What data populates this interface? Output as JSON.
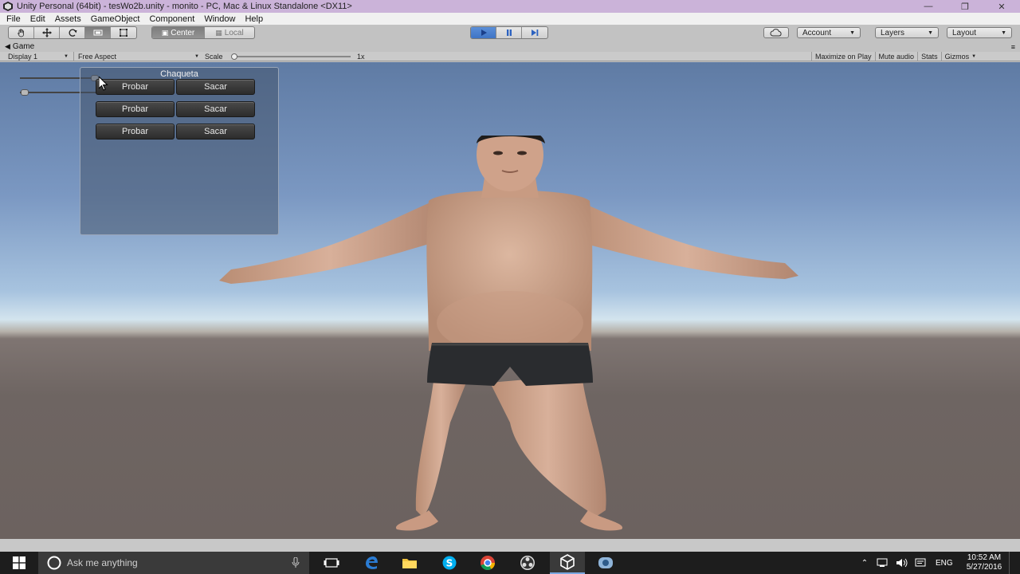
{
  "window": {
    "title": "Unity Personal (64bit) - tesWo2b.unity - monito - PC, Mac & Linux Standalone <DX11>"
  },
  "menu": [
    "File",
    "Edit",
    "Assets",
    "GameObject",
    "Component",
    "Window",
    "Help"
  ],
  "toolbar": {
    "pivot_center": "Center",
    "pivot_local": "Local",
    "account": "Account",
    "layers": "Layers",
    "layout": "Layout"
  },
  "game_view": {
    "tab_label": "Game",
    "display": "Display 1",
    "aspect": "Free Aspect",
    "scale_label": "Scale",
    "scale_value": "1x",
    "maximize_on_play": "Maximize on Play",
    "mute_audio": "Mute audio",
    "stats": "Stats",
    "gizmos": "Gizmos"
  },
  "gui_panel": {
    "title": "Chaqueta",
    "rows": [
      {
        "try": "Probar",
        "remove": "Sacar"
      },
      {
        "try": "Probar",
        "remove": "Sacar"
      },
      {
        "try": "Probar",
        "remove": "Sacar"
      }
    ]
  },
  "taskbar": {
    "search_placeholder": "Ask me anything",
    "language": "ENG",
    "time": "10:52 AM",
    "date": "5/27/2016"
  },
  "colors": {
    "title_bar": "#cbb3d9",
    "play_active": "#3f74c5",
    "taskbar": "#1d1d1d"
  }
}
